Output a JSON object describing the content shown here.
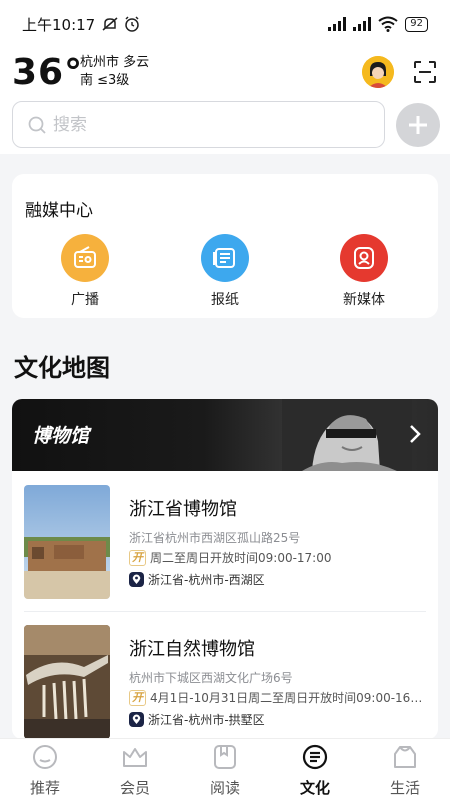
{
  "status_bar": {
    "time": "上午10:17",
    "battery": "92"
  },
  "weather": {
    "temperature": "36°",
    "city_condition": "杭州市 多云",
    "wind": "南 ≤3级"
  },
  "search": {
    "placeholder": "搜索"
  },
  "media_center": {
    "title": "融媒中心",
    "items": [
      {
        "label": "广播",
        "icon": "radio-icon",
        "color": "#f6b13d"
      },
      {
        "label": "报纸",
        "icon": "newspaper-icon",
        "color": "#3da8ee"
      },
      {
        "label": "新媒体",
        "icon": "new-media-icon",
        "color": "#e5392f"
      }
    ]
  },
  "culture_map": {
    "title": "文化地图",
    "banner_title": "博物馆",
    "museums": [
      {
        "name": "浙江省博物馆",
        "address": "浙江省杭州市西湖区孤山路25号",
        "open_tag": "开",
        "hours": "周二至周日开放时间09:00-17:00",
        "region": "浙江省-杭州市-西湖区"
      },
      {
        "name": "浙江自然博物馆",
        "address": "杭州市下城区西湖文化广场6号",
        "open_tag": "开",
        "hours": "4月1日-10月31日周二至周日开放时间09:00-16:...",
        "region": "浙江省-杭州市-拱墅区"
      }
    ]
  },
  "tabs": [
    {
      "label": "推荐",
      "icon": "recommend-icon",
      "active": false
    },
    {
      "label": "会员",
      "icon": "crown-icon",
      "active": false
    },
    {
      "label": "阅读",
      "icon": "book-icon",
      "active": false
    },
    {
      "label": "文化",
      "icon": "culture-icon",
      "active": true
    },
    {
      "label": "生活",
      "icon": "life-icon",
      "active": false
    }
  ],
  "colors": {
    "accent": "#111111",
    "tab_inactive": "#b8b9bd"
  }
}
